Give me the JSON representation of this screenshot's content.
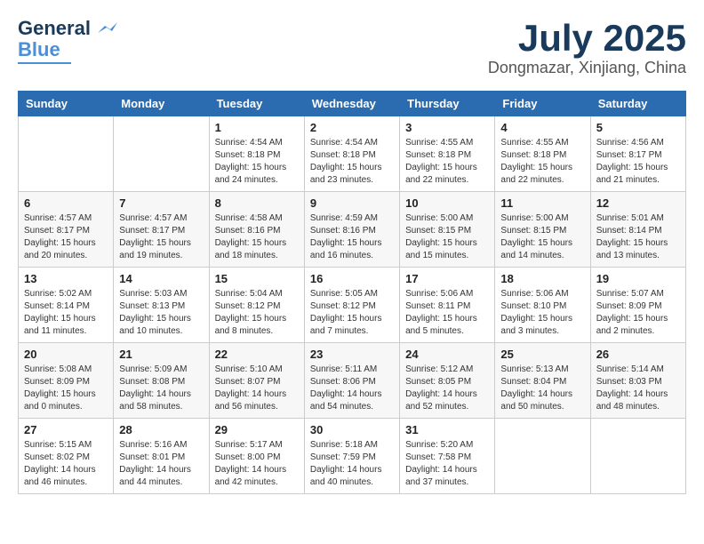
{
  "logo": {
    "line1": "General",
    "line2": "Blue"
  },
  "title": "July 2025",
  "location": "Dongmazar, Xinjiang, China",
  "weekdays": [
    "Sunday",
    "Monday",
    "Tuesday",
    "Wednesday",
    "Thursday",
    "Friday",
    "Saturday"
  ],
  "weeks": [
    [
      {
        "day": "",
        "info": ""
      },
      {
        "day": "",
        "info": ""
      },
      {
        "day": "1",
        "info": "Sunrise: 4:54 AM\nSunset: 8:18 PM\nDaylight: 15 hours\nand 24 minutes."
      },
      {
        "day": "2",
        "info": "Sunrise: 4:54 AM\nSunset: 8:18 PM\nDaylight: 15 hours\nand 23 minutes."
      },
      {
        "day": "3",
        "info": "Sunrise: 4:55 AM\nSunset: 8:18 PM\nDaylight: 15 hours\nand 22 minutes."
      },
      {
        "day": "4",
        "info": "Sunrise: 4:55 AM\nSunset: 8:18 PM\nDaylight: 15 hours\nand 22 minutes."
      },
      {
        "day": "5",
        "info": "Sunrise: 4:56 AM\nSunset: 8:17 PM\nDaylight: 15 hours\nand 21 minutes."
      }
    ],
    [
      {
        "day": "6",
        "info": "Sunrise: 4:57 AM\nSunset: 8:17 PM\nDaylight: 15 hours\nand 20 minutes."
      },
      {
        "day": "7",
        "info": "Sunrise: 4:57 AM\nSunset: 8:17 PM\nDaylight: 15 hours\nand 19 minutes."
      },
      {
        "day": "8",
        "info": "Sunrise: 4:58 AM\nSunset: 8:16 PM\nDaylight: 15 hours\nand 18 minutes."
      },
      {
        "day": "9",
        "info": "Sunrise: 4:59 AM\nSunset: 8:16 PM\nDaylight: 15 hours\nand 16 minutes."
      },
      {
        "day": "10",
        "info": "Sunrise: 5:00 AM\nSunset: 8:15 PM\nDaylight: 15 hours\nand 15 minutes."
      },
      {
        "day": "11",
        "info": "Sunrise: 5:00 AM\nSunset: 8:15 PM\nDaylight: 15 hours\nand 14 minutes."
      },
      {
        "day": "12",
        "info": "Sunrise: 5:01 AM\nSunset: 8:14 PM\nDaylight: 15 hours\nand 13 minutes."
      }
    ],
    [
      {
        "day": "13",
        "info": "Sunrise: 5:02 AM\nSunset: 8:14 PM\nDaylight: 15 hours\nand 11 minutes."
      },
      {
        "day": "14",
        "info": "Sunrise: 5:03 AM\nSunset: 8:13 PM\nDaylight: 15 hours\nand 10 minutes."
      },
      {
        "day": "15",
        "info": "Sunrise: 5:04 AM\nSunset: 8:12 PM\nDaylight: 15 hours\nand 8 minutes."
      },
      {
        "day": "16",
        "info": "Sunrise: 5:05 AM\nSunset: 8:12 PM\nDaylight: 15 hours\nand 7 minutes."
      },
      {
        "day": "17",
        "info": "Sunrise: 5:06 AM\nSunset: 8:11 PM\nDaylight: 15 hours\nand 5 minutes."
      },
      {
        "day": "18",
        "info": "Sunrise: 5:06 AM\nSunset: 8:10 PM\nDaylight: 15 hours\nand 3 minutes."
      },
      {
        "day": "19",
        "info": "Sunrise: 5:07 AM\nSunset: 8:09 PM\nDaylight: 15 hours\nand 2 minutes."
      }
    ],
    [
      {
        "day": "20",
        "info": "Sunrise: 5:08 AM\nSunset: 8:09 PM\nDaylight: 15 hours\nand 0 minutes."
      },
      {
        "day": "21",
        "info": "Sunrise: 5:09 AM\nSunset: 8:08 PM\nDaylight: 14 hours\nand 58 minutes."
      },
      {
        "day": "22",
        "info": "Sunrise: 5:10 AM\nSunset: 8:07 PM\nDaylight: 14 hours\nand 56 minutes."
      },
      {
        "day": "23",
        "info": "Sunrise: 5:11 AM\nSunset: 8:06 PM\nDaylight: 14 hours\nand 54 minutes."
      },
      {
        "day": "24",
        "info": "Sunrise: 5:12 AM\nSunset: 8:05 PM\nDaylight: 14 hours\nand 52 minutes."
      },
      {
        "day": "25",
        "info": "Sunrise: 5:13 AM\nSunset: 8:04 PM\nDaylight: 14 hours\nand 50 minutes."
      },
      {
        "day": "26",
        "info": "Sunrise: 5:14 AM\nSunset: 8:03 PM\nDaylight: 14 hours\nand 48 minutes."
      }
    ],
    [
      {
        "day": "27",
        "info": "Sunrise: 5:15 AM\nSunset: 8:02 PM\nDaylight: 14 hours\nand 46 minutes."
      },
      {
        "day": "28",
        "info": "Sunrise: 5:16 AM\nSunset: 8:01 PM\nDaylight: 14 hours\nand 44 minutes."
      },
      {
        "day": "29",
        "info": "Sunrise: 5:17 AM\nSunset: 8:00 PM\nDaylight: 14 hours\nand 42 minutes."
      },
      {
        "day": "30",
        "info": "Sunrise: 5:18 AM\nSunset: 7:59 PM\nDaylight: 14 hours\nand 40 minutes."
      },
      {
        "day": "31",
        "info": "Sunrise: 5:20 AM\nSunset: 7:58 PM\nDaylight: 14 hours\nand 37 minutes."
      },
      {
        "day": "",
        "info": ""
      },
      {
        "day": "",
        "info": ""
      }
    ]
  ]
}
